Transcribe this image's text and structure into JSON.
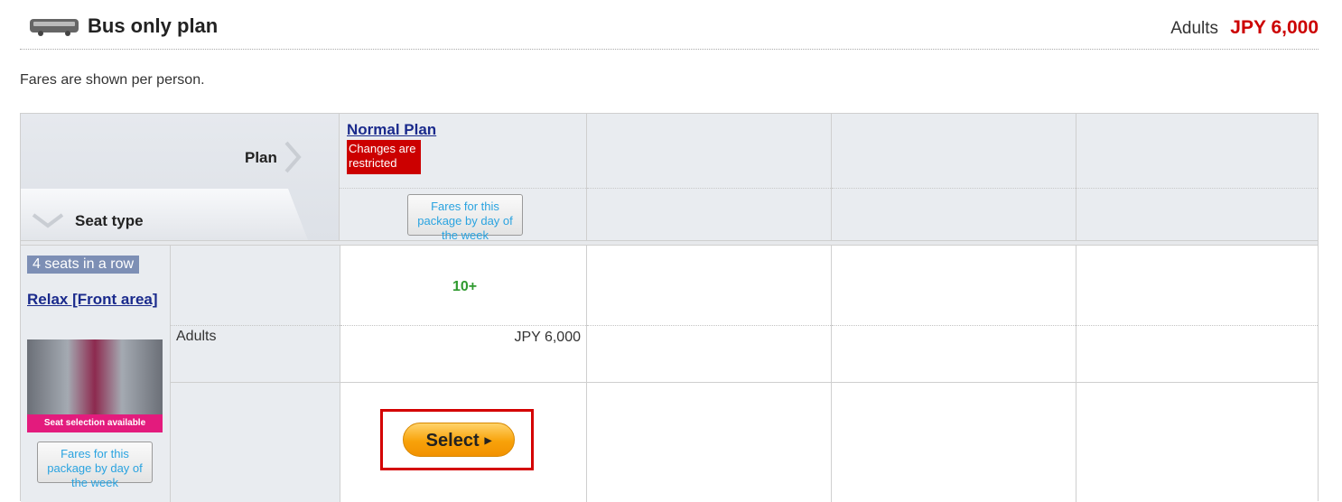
{
  "header": {
    "title": "Bus only plan",
    "price_label": "Adults",
    "price_value": "JPY 6,000",
    "icon": "bus-icon"
  },
  "note": "Fares are shown per person.",
  "table": {
    "plan_header": "Plan",
    "seat_header": "Seat type",
    "plans": [
      {
        "name": "Normal Plan",
        "badge": "Changes are restricted",
        "fares_button": "Fares for this package by day of the week"
      }
    ],
    "seat": {
      "badge": "4 seats in a row",
      "name": "Relax [Front area]",
      "photo_caption": "Seat selection available",
      "fares_button": "Fares for this package by day of the week"
    },
    "row_label": "Adults",
    "availability": "10+",
    "price": "JPY 6,000",
    "select_label": "Select"
  },
  "colors": {
    "price_red": "#cc0000",
    "link_blue": "#1a2a8c",
    "badge_red": "#cc0000",
    "seat_badge": "#7d8fb5",
    "availability_green": "#2f9a2f",
    "select_orange": "#f8a20a",
    "highlight_red": "#d40000"
  }
}
